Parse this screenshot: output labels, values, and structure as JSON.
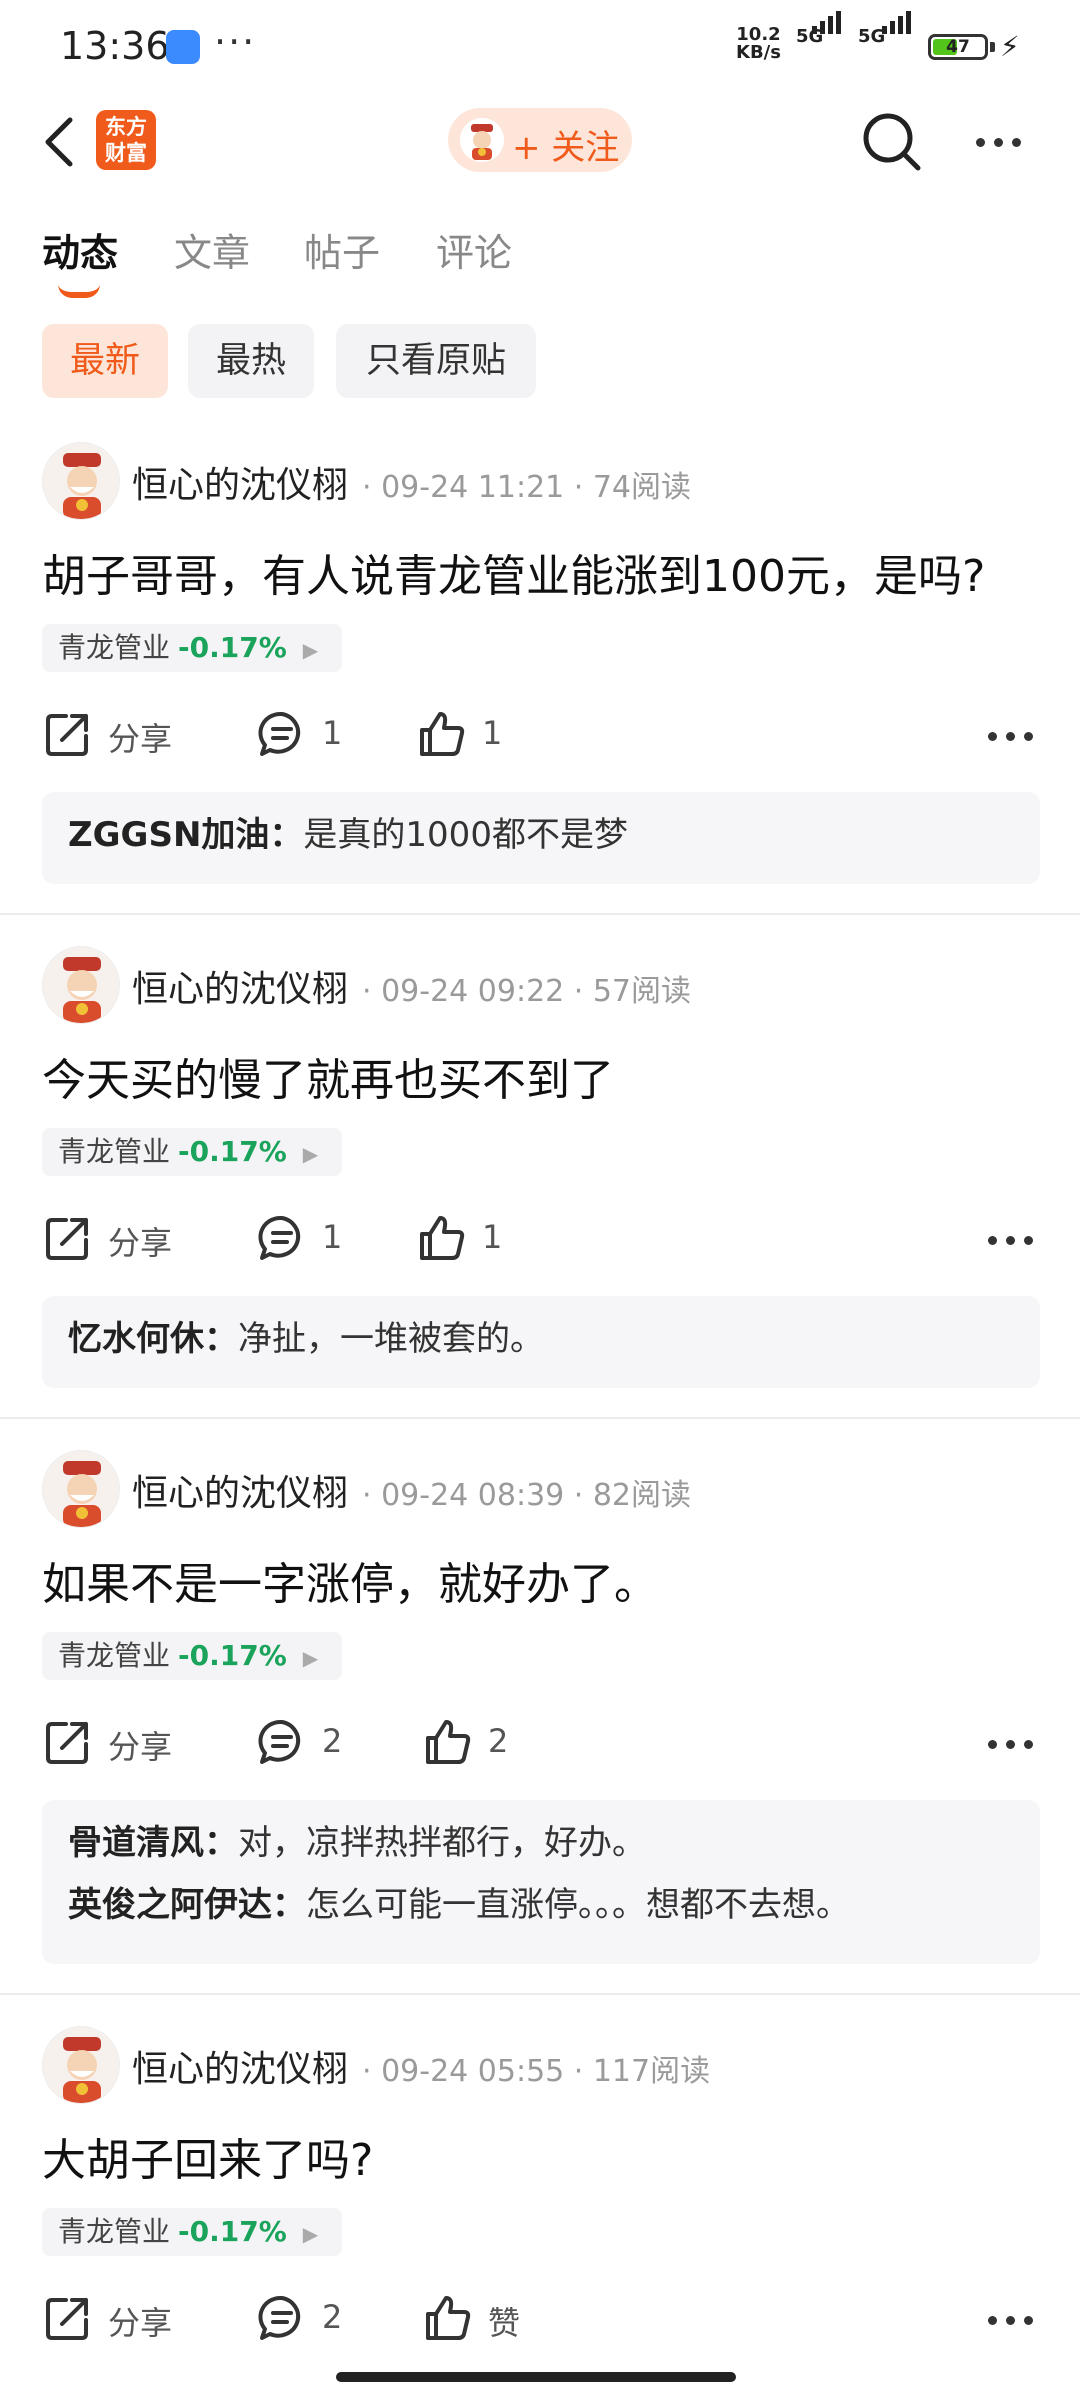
{
  "status_bar": {
    "time": "13:36",
    "more": "···",
    "speed_value": "10.2",
    "speed_unit": "KB/s",
    "net1": "5G",
    "net2": "5G",
    "battery": "47",
    "battery_level": 0.47,
    "icons": [
      "app-icon",
      "signal-icon",
      "battery-icon",
      "charging-icon"
    ]
  },
  "nav": {
    "logo_line1": "东方",
    "logo_line2": "财富",
    "follow_label": "+ 关注",
    "icons": [
      "back-arrow-icon",
      "search-icon",
      "more-dots-icon"
    ],
    "accent": "#f05a1a"
  },
  "tabs": [
    "动态",
    "文章",
    "帖子",
    "评论"
  ],
  "filters": [
    "最新",
    "最热",
    "只看原贴"
  ],
  "colors": {
    "accent": "#f05a1a",
    "positive_change": "#1aa35a",
    "chip_bg": "#f3f3f5",
    "active_chip_bg": "#fde6d9"
  },
  "posts": [
    {
      "author": "恒心的沈仪栩",
      "meta": "· 09-24 11:21 · 74阅读",
      "title": "胡子哥哥，有人说青龙管业能涨到100元，是吗?",
      "stock": "青龙管业",
      "change": "-0.17%",
      "share": "分享",
      "comments": "1",
      "likes": "1",
      "replies": [
        {
          "user": "ZGGSN加油：",
          "text": "是真的1000都不是梦"
        }
      ]
    },
    {
      "author": "恒心的沈仪栩",
      "meta": "· 09-24 09:22 · 57阅读",
      "title": "今天买的慢了就再也买不到了",
      "stock": "青龙管业",
      "change": "-0.17%",
      "share": "分享",
      "comments": "1",
      "likes": "1",
      "replies": [
        {
          "user": "忆水何休：",
          "text": "净扯，一堆被套的。"
        }
      ]
    },
    {
      "author": "恒心的沈仪栩",
      "meta": "· 09-24 08:39 · 82阅读",
      "title": "如果不是一字涨停，就好办了。",
      "stock": "青龙管业",
      "change": "-0.17%",
      "share": "分享",
      "comments": "2",
      "likes": "2",
      "replies": [
        {
          "user": "骨道清风：",
          "text": "对，凉拌热拌都行，好办。"
        },
        {
          "user": "英俊之阿伊达：",
          "text": "怎么可能一直涨停。。。想都不去想。"
        }
      ]
    },
    {
      "author": "恒心的沈仪栩",
      "meta": "· 09-24 05:55 · 117阅读",
      "title": "大胡子回来了吗?",
      "stock": "青龙管业",
      "change": "-0.17%",
      "share": "分享",
      "comments": "2",
      "likes": "赞",
      "replies": []
    }
  ]
}
